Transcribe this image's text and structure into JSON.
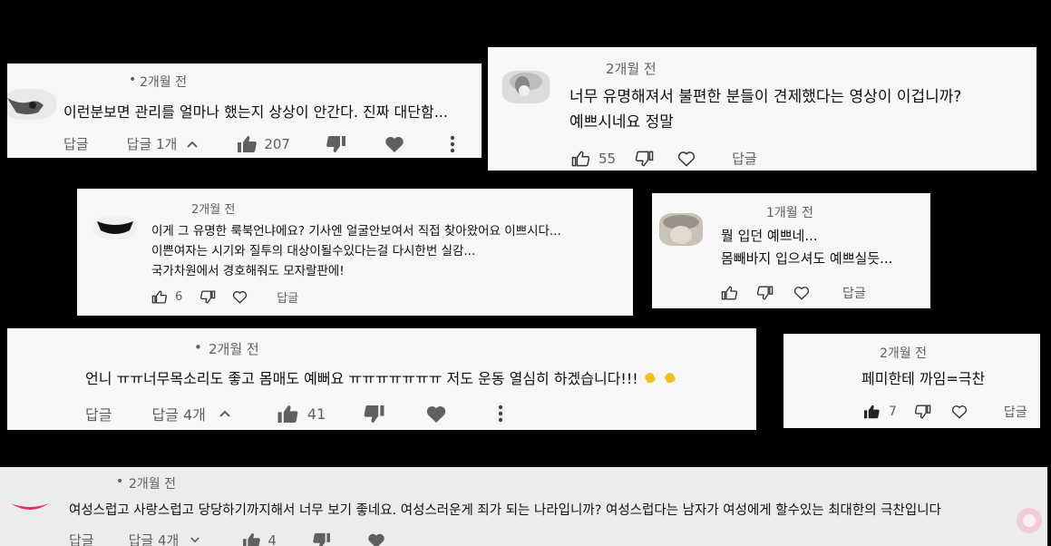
{
  "comments": [
    {
      "id": "c1",
      "time": "2개월 전",
      "lines": [
        "이런분보면 관리를 얼마나 했는지 상상이 안간다. 진짜 대단함..."
      ],
      "reply_label": "답글",
      "replies_label": "답글 1개",
      "likes": "207"
    },
    {
      "id": "c2",
      "time": "2개월 전",
      "lines": [
        "너무 유명해져서 불편한 분들이 견제했다는 영상이 이겁니까?",
        "예쁘시네요 정말"
      ],
      "reply_label": "답글",
      "likes": "55"
    },
    {
      "id": "c3",
      "time": "2개월 전",
      "lines": [
        "이게 그 유명한 룩북언냐에요? 기사엔 얼굴안보여서 직접 찾아왔어요 이쁘시다...",
        "이쁜여자는 시기와 질투의 대상이될수있다는걸 다시한번 실감...",
        "국가차원에서 경호해줘도 모자랄판에!"
      ],
      "reply_label": "답글",
      "likes": "6"
    },
    {
      "id": "c4",
      "time": "1개월 전",
      "lines": [
        "뭘 입던 예쁘네...",
        "몸빼바지 입으셔도 예쁘실듯..."
      ],
      "reply_label": "답글"
    },
    {
      "id": "c5",
      "time": "2개월 전",
      "lines": [
        "언니 ㅠㅠ너무목소리도 좋고 몸매도 예뻐요 ㅠㅠㅠㅠㅠㅠㅠ 저도 운동 열심히 하겠습니다!!!"
      ],
      "reply_label": "답글",
      "replies_label": "답글 4개",
      "likes": "41"
    },
    {
      "id": "c6",
      "time": "2개월 전",
      "lines": [
        "페미한테 까임=극찬"
      ],
      "reply_label": "답글",
      "likes": "7"
    },
    {
      "id": "c7",
      "time": "2개월 전",
      "lines": [
        "여성스럽고 사랑스럽고 당당하기까지해서 너무 보기 좋네요. 여성스러운게 죄가 되는 나라입니까? 여성스럽다는 남자가 여성에게 할수있는 최대한의 극찬입니다"
      ],
      "reply_label": "답글",
      "replies_label": "답글 4개",
      "likes": "4"
    }
  ],
  "icons": {
    "like": "thumb-up-icon",
    "dislike": "thumb-down-icon",
    "heart": "heart-icon",
    "more": "more-vert-icon",
    "expand": "chevron-icon"
  },
  "colors": {
    "background": "#000000",
    "card": "#f7f7f7",
    "meta_text": "#606060",
    "comment_text": "#0f0f0f",
    "heart_filled": "#606060"
  }
}
